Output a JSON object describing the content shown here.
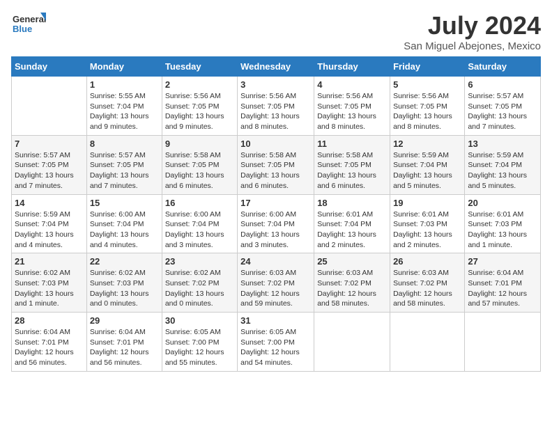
{
  "header": {
    "logo_line1": "General",
    "logo_line2": "Blue",
    "month": "July 2024",
    "location": "San Miguel Abejones, Mexico"
  },
  "days_of_week": [
    "Sunday",
    "Monday",
    "Tuesday",
    "Wednesday",
    "Thursday",
    "Friday",
    "Saturday"
  ],
  "weeks": [
    [
      {
        "day": "",
        "info": ""
      },
      {
        "day": "1",
        "info": "Sunrise: 5:55 AM\nSunset: 7:04 PM\nDaylight: 13 hours\nand 9 minutes."
      },
      {
        "day": "2",
        "info": "Sunrise: 5:56 AM\nSunset: 7:05 PM\nDaylight: 13 hours\nand 9 minutes."
      },
      {
        "day": "3",
        "info": "Sunrise: 5:56 AM\nSunset: 7:05 PM\nDaylight: 13 hours\nand 8 minutes."
      },
      {
        "day": "4",
        "info": "Sunrise: 5:56 AM\nSunset: 7:05 PM\nDaylight: 13 hours\nand 8 minutes."
      },
      {
        "day": "5",
        "info": "Sunrise: 5:56 AM\nSunset: 7:05 PM\nDaylight: 13 hours\nand 8 minutes."
      },
      {
        "day": "6",
        "info": "Sunrise: 5:57 AM\nSunset: 7:05 PM\nDaylight: 13 hours\nand 7 minutes."
      }
    ],
    [
      {
        "day": "7",
        "info": "Sunrise: 5:57 AM\nSunset: 7:05 PM\nDaylight: 13 hours\nand 7 minutes."
      },
      {
        "day": "8",
        "info": "Sunrise: 5:57 AM\nSunset: 7:05 PM\nDaylight: 13 hours\nand 7 minutes."
      },
      {
        "day": "9",
        "info": "Sunrise: 5:58 AM\nSunset: 7:05 PM\nDaylight: 13 hours\nand 6 minutes."
      },
      {
        "day": "10",
        "info": "Sunrise: 5:58 AM\nSunset: 7:05 PM\nDaylight: 13 hours\nand 6 minutes."
      },
      {
        "day": "11",
        "info": "Sunrise: 5:58 AM\nSunset: 7:05 PM\nDaylight: 13 hours\nand 6 minutes."
      },
      {
        "day": "12",
        "info": "Sunrise: 5:59 AM\nSunset: 7:04 PM\nDaylight: 13 hours\nand 5 minutes."
      },
      {
        "day": "13",
        "info": "Sunrise: 5:59 AM\nSunset: 7:04 PM\nDaylight: 13 hours\nand 5 minutes."
      }
    ],
    [
      {
        "day": "14",
        "info": "Sunrise: 5:59 AM\nSunset: 7:04 PM\nDaylight: 13 hours\nand 4 minutes."
      },
      {
        "day": "15",
        "info": "Sunrise: 6:00 AM\nSunset: 7:04 PM\nDaylight: 13 hours\nand 4 minutes."
      },
      {
        "day": "16",
        "info": "Sunrise: 6:00 AM\nSunset: 7:04 PM\nDaylight: 13 hours\nand 3 minutes."
      },
      {
        "day": "17",
        "info": "Sunrise: 6:00 AM\nSunset: 7:04 PM\nDaylight: 13 hours\nand 3 minutes."
      },
      {
        "day": "18",
        "info": "Sunrise: 6:01 AM\nSunset: 7:04 PM\nDaylight: 13 hours\nand 2 minutes."
      },
      {
        "day": "19",
        "info": "Sunrise: 6:01 AM\nSunset: 7:03 PM\nDaylight: 13 hours\nand 2 minutes."
      },
      {
        "day": "20",
        "info": "Sunrise: 6:01 AM\nSunset: 7:03 PM\nDaylight: 13 hours\nand 1 minute."
      }
    ],
    [
      {
        "day": "21",
        "info": "Sunrise: 6:02 AM\nSunset: 7:03 PM\nDaylight: 13 hours\nand 1 minute."
      },
      {
        "day": "22",
        "info": "Sunrise: 6:02 AM\nSunset: 7:03 PM\nDaylight: 13 hours\nand 0 minutes."
      },
      {
        "day": "23",
        "info": "Sunrise: 6:02 AM\nSunset: 7:02 PM\nDaylight: 13 hours\nand 0 minutes."
      },
      {
        "day": "24",
        "info": "Sunrise: 6:03 AM\nSunset: 7:02 PM\nDaylight: 12 hours\nand 59 minutes."
      },
      {
        "day": "25",
        "info": "Sunrise: 6:03 AM\nSunset: 7:02 PM\nDaylight: 12 hours\nand 58 minutes."
      },
      {
        "day": "26",
        "info": "Sunrise: 6:03 AM\nSunset: 7:02 PM\nDaylight: 12 hours\nand 58 minutes."
      },
      {
        "day": "27",
        "info": "Sunrise: 6:04 AM\nSunset: 7:01 PM\nDaylight: 12 hours\nand 57 minutes."
      }
    ],
    [
      {
        "day": "28",
        "info": "Sunrise: 6:04 AM\nSunset: 7:01 PM\nDaylight: 12 hours\nand 56 minutes."
      },
      {
        "day": "29",
        "info": "Sunrise: 6:04 AM\nSunset: 7:01 PM\nDaylight: 12 hours\nand 56 minutes."
      },
      {
        "day": "30",
        "info": "Sunrise: 6:05 AM\nSunset: 7:00 PM\nDaylight: 12 hours\nand 55 minutes."
      },
      {
        "day": "31",
        "info": "Sunrise: 6:05 AM\nSunset: 7:00 PM\nDaylight: 12 hours\nand 54 minutes."
      },
      {
        "day": "",
        "info": ""
      },
      {
        "day": "",
        "info": ""
      },
      {
        "day": "",
        "info": ""
      }
    ]
  ]
}
